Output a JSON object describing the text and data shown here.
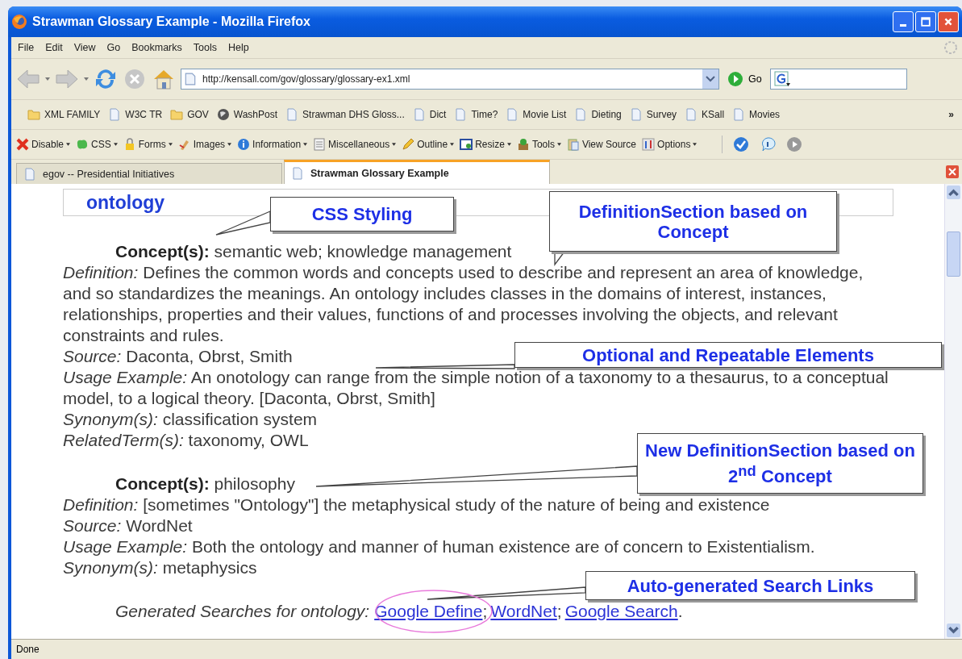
{
  "window": {
    "title": "Strawman Glossary Example - Mozilla Firefox"
  },
  "menu": [
    "File",
    "Edit",
    "View",
    "Go",
    "Bookmarks",
    "Tools",
    "Help"
  ],
  "navigation": {
    "url": "http://kensall.com/gov/glossary/glossary-ex1.xml",
    "go": "Go"
  },
  "bookmarks": [
    {
      "label": "XML FAMILY",
      "kind": "folder"
    },
    {
      "label": "W3C TR",
      "kind": "page"
    },
    {
      "label": "GOV",
      "kind": "folder"
    },
    {
      "label": "WashPost",
      "kind": "globe"
    },
    {
      "label": "Strawman DHS Gloss...",
      "kind": "page"
    },
    {
      "label": "Dict",
      "kind": "page"
    },
    {
      "label": "Time?",
      "kind": "page"
    },
    {
      "label": "Movie List",
      "kind": "page"
    },
    {
      "label": "Dieting",
      "kind": "page"
    },
    {
      "label": "Survey",
      "kind": "page"
    },
    {
      "label": "KSall",
      "kind": "page"
    },
    {
      "label": "Movies",
      "kind": "page"
    }
  ],
  "bookmarks_overflow": "»",
  "devtools": [
    {
      "label": "Disable",
      "kind": "cross",
      "menu": true
    },
    {
      "label": "CSS",
      "kind": "blob",
      "menu": true
    },
    {
      "label": "Forms",
      "kind": "padlock",
      "menu": true
    },
    {
      "label": "Images",
      "kind": "brush",
      "menu": true
    },
    {
      "label": "Information",
      "kind": "info",
      "menu": true
    },
    {
      "label": "Miscellaneous",
      "kind": "list",
      "menu": true
    },
    {
      "label": "Outline",
      "kind": "pencil",
      "menu": true
    },
    {
      "label": "Resize",
      "kind": "window",
      "menu": true
    },
    {
      "label": "Tools",
      "kind": "box",
      "menu": true
    },
    {
      "label": "View Source",
      "kind": "clipboard",
      "menu": false
    },
    {
      "label": "Options",
      "kind": "bars",
      "menu": true
    }
  ],
  "tabs": [
    {
      "label": "egov -- Presidential Initiatives",
      "selected": false
    },
    {
      "label": "Strawman Glossary Example",
      "selected": true
    }
  ],
  "page": {
    "term": "ontology",
    "sections": [
      {
        "concept_label": "Concept(s):",
        "concept": "semantic web; knowledge management",
        "fields": [
          {
            "label": "Definition:",
            "value": "Defines the common words and concepts used to describe and represent an area of knowledge, and so standardizes the meanings. An ontology includes classes in the domains of interest, instances, relationships, properties and their values, functions of and processes involving the objects, and relevant constraints and rules."
          },
          {
            "label": "Source:",
            "value": "Daconta, Obrst, Smith"
          },
          {
            "label": "Usage Example:",
            "value": "An onotology can range from the simple notion of a taxonomy to a thesaurus, to a conceptual model, to a logical theory. [Daconta, Obrst, Smith]"
          },
          {
            "label": "Synonym(s):",
            "value": "classification system"
          },
          {
            "label": "RelatedTerm(s):",
            "value": "taxonomy, OWL"
          }
        ]
      },
      {
        "concept_label": "Concept(s):",
        "concept": "philosophy",
        "fields": [
          {
            "label": "Definition:",
            "value": "[sometimes \"Ontology\"] the metaphysical study of the nature of being and existence"
          },
          {
            "label": "Source:",
            "value": "WordNet"
          },
          {
            "label": "Usage Example:",
            "value": "Both the ontology and manner of human existence are of concern to Existentialism."
          },
          {
            "label": "Synonym(s):",
            "value": "metaphysics"
          }
        ]
      }
    ],
    "searches": {
      "label": "Generated Searches for ontology:",
      "links": [
        "Google Define",
        "WordNet",
        "Google Search"
      ],
      "separator": ";",
      "end": "."
    }
  },
  "callouts": [
    {
      "text": "CSS Styling"
    },
    {
      "text": "DefinitionSection based on Concept"
    },
    {
      "text": "Optional and Repeatable Elements"
    },
    {
      "text": "New DefinitionSection based on 2$^{nd}$ Concept"
    },
    {
      "text": "Auto-generated Search Links"
    }
  ],
  "status_bar": {
    "text": "Done"
  }
}
